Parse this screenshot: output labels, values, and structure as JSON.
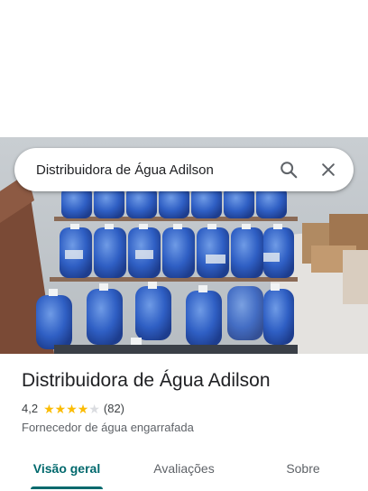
{
  "search": {
    "query": "Distribuidora de Água Adilson"
  },
  "place": {
    "name": "Distribuidora de Água Adilson",
    "rating": "4,2",
    "rating_value": 4.2,
    "review_count": "(82)",
    "category": "Fornecedor de água engarrafada"
  },
  "tabs": [
    {
      "label": "Visão geral",
      "active": true
    },
    {
      "label": "Avaliações",
      "active": false
    },
    {
      "label": "Sobre",
      "active": false
    }
  ],
  "colors": {
    "accent": "#01696d",
    "star": "#fbbc04"
  },
  "icons": {
    "search": "search-icon",
    "close": "close-icon",
    "star": "star-icon"
  }
}
